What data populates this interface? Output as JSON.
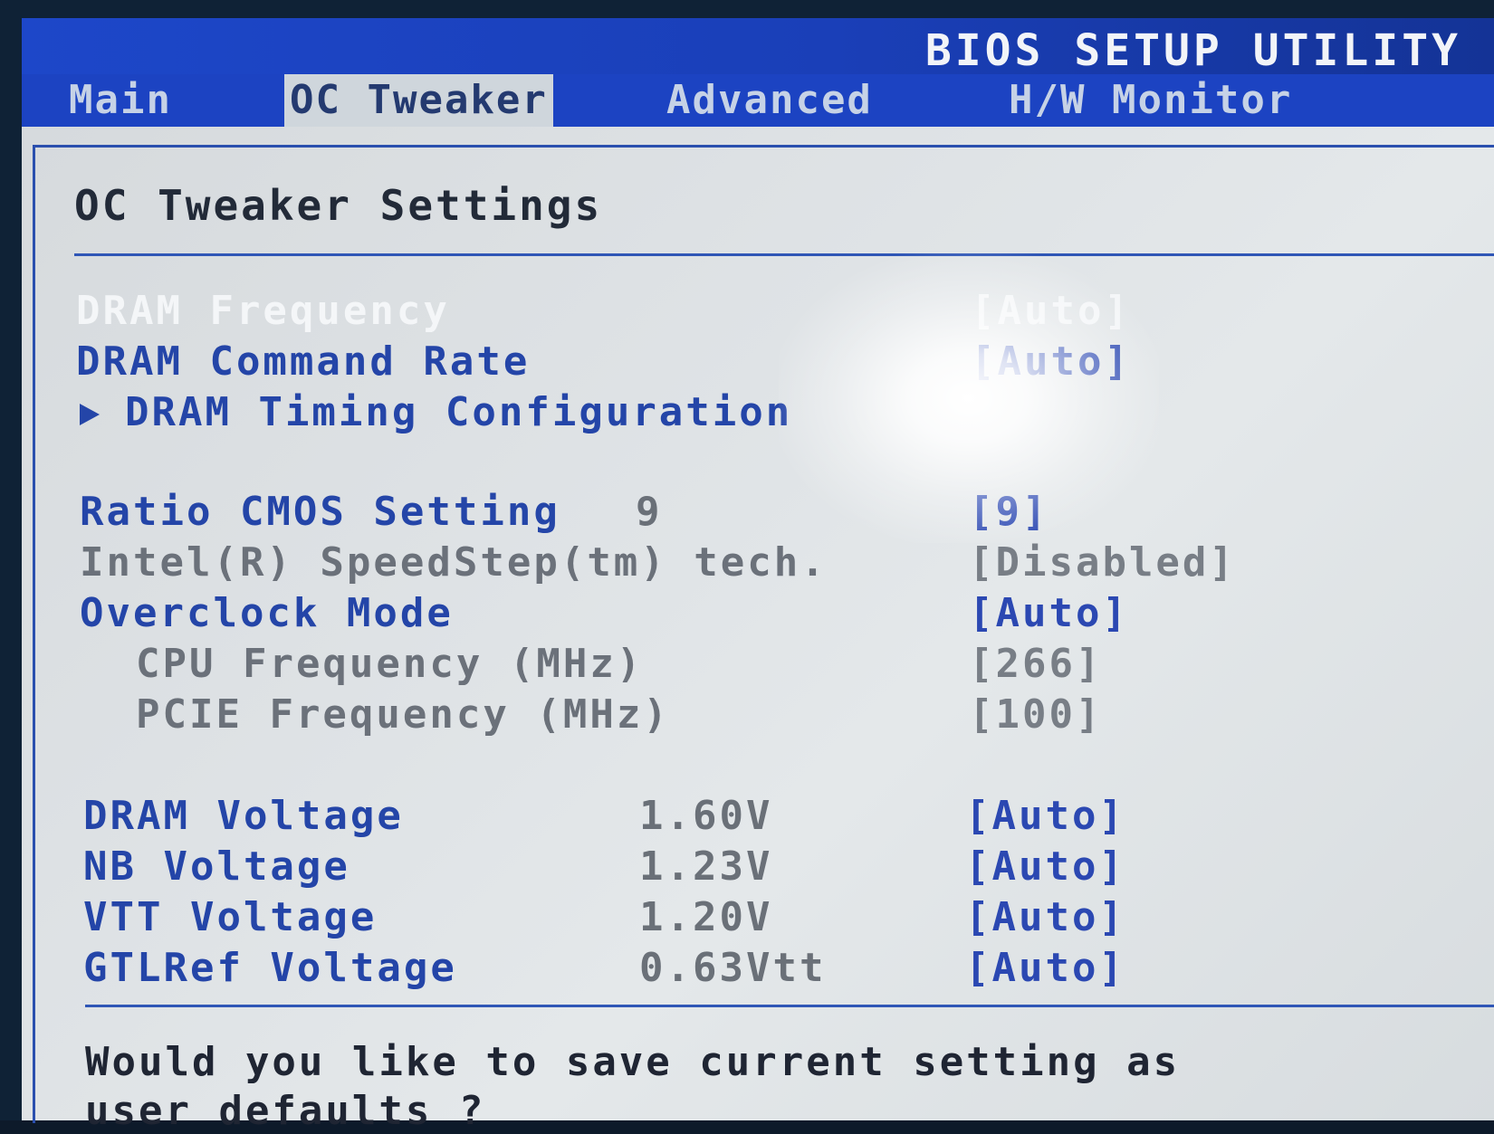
{
  "header": {
    "app_title": "BIOS SETUP UTILITY"
  },
  "tabs": [
    {
      "label": "Main"
    },
    {
      "label": "OC Tweaker",
      "active": true
    },
    {
      "label": "Advanced"
    },
    {
      "label": "H/W Monitor"
    }
  ],
  "section": {
    "title": "OC Tweaker Settings"
  },
  "settings": {
    "dram_frequency": {
      "label": "DRAM Frequency",
      "value": "[Auto]",
      "selected": true
    },
    "dram_command_rate": {
      "label": "DRAM Command Rate",
      "value": "[Auto]"
    },
    "dram_timing": {
      "label": "DRAM Timing Configuration",
      "submenu": true
    },
    "ratio_cmos": {
      "label": "Ratio CMOS Setting",
      "reading": "9",
      "value": "[9]"
    },
    "speedstep": {
      "label": "Intel(R) SpeedStep(tm) tech.",
      "value": "[Disabled]",
      "dim": true
    },
    "overclock_mode": {
      "label": "Overclock Mode",
      "value": "[Auto]"
    },
    "cpu_frequency": {
      "label": "CPU Frequency (MHz)",
      "value": "[266]",
      "dim": true
    },
    "pcie_frequency": {
      "label": "PCIE Frequency (MHz)",
      "value": "[100]",
      "dim": true
    },
    "dram_voltage": {
      "label": "DRAM Voltage",
      "reading": "1.60V",
      "value": "[Auto]"
    },
    "nb_voltage": {
      "label": "NB Voltage",
      "reading": "1.23V",
      "value": "[Auto]"
    },
    "vtt_voltage": {
      "label": "VTT Voltage",
      "reading": "1.20V",
      "value": "[Auto]"
    },
    "gtlref_voltage": {
      "label": "GTLRef Voltage",
      "reading": "0.63Vtt",
      "value": "[Auto]"
    }
  },
  "prompt": {
    "line1": "Would you like to save current setting as",
    "line2": "user defaults ?"
  },
  "colors": {
    "title_bar": "#1d47c9",
    "panel_bg": "#dfe3e6",
    "setting_text": "#2445a8",
    "selected_text": "#f4f6f8"
  }
}
